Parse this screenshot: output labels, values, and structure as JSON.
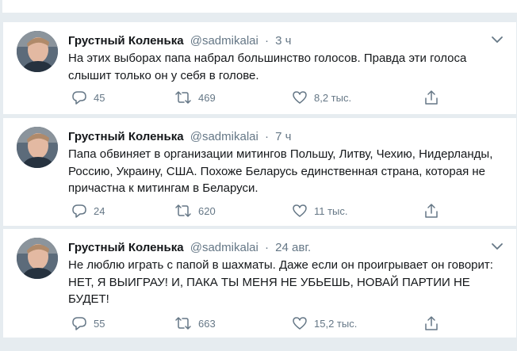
{
  "tweets": [
    {
      "name": "Грустный Коленька",
      "handle": "@sadmikalai",
      "dot": "·",
      "time": "3 ч",
      "text": "На этих выборах папа набрал большинство голосов. Правда эти голоса слышит только он у себя в голове.",
      "replies": "45",
      "retweets": "469",
      "likes": "8,2 тыс."
    },
    {
      "name": "Грустный Коленька",
      "handle": "@sadmikalai",
      "dot": "·",
      "time": "7 ч",
      "text": "Папа обвиняет в организации митингов Польшу, Литву, Чехию, Нидерланды, Россию, Украину, США. Похоже Беларусь единственная страна, которая не причастна к митингам в Беларуси.",
      "replies": "24",
      "retweets": "620",
      "likes": "11 тыс."
    },
    {
      "name": "Грустный Коленька",
      "handle": "@sadmikalai",
      "dot": "·",
      "time": "24 авг.",
      "text": "Не люблю играть с папой в шахматы. Даже если он проигрывает он говорит: НЕТ, Я ВЫИГРАУ! И, ПАКА ТЫ МЕНЯ НЕ УБЬЕШЬ, НОВАЙ ПАРТИИ НЕ БУДЕТ!",
      "replies": "55",
      "retweets": "663",
      "likes": "15,2 тыс."
    }
  ],
  "icons": {
    "reply": "reply-icon",
    "retweet": "retweet-icon",
    "like": "like-icon",
    "share": "share-icon",
    "caret": "chevron-down-icon"
  },
  "colors": {
    "icon_gray": "#657786",
    "separator": "#e6ecf0"
  }
}
